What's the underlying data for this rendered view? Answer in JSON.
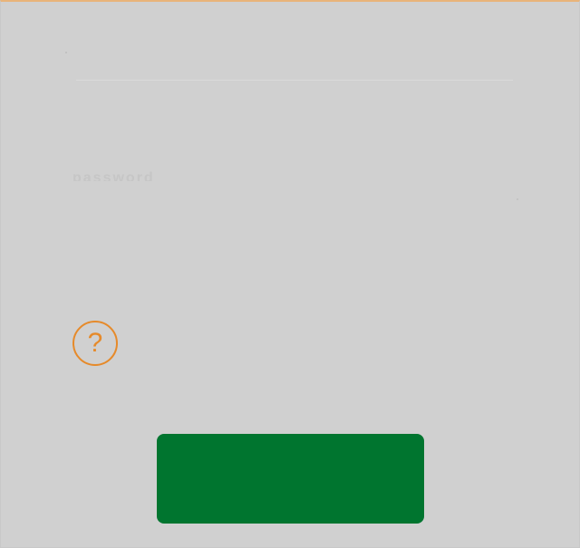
{
  "form": {
    "password_label_faded": "password",
    "help_text_faded": "",
    "primary_button_label": ""
  },
  "icons": {
    "help": "question-mark-circle-icon",
    "help_glyph": "?"
  },
  "colors": {
    "background": "#d0d0d0",
    "accent": "#e68a2a",
    "primary_button": "#00752f"
  }
}
